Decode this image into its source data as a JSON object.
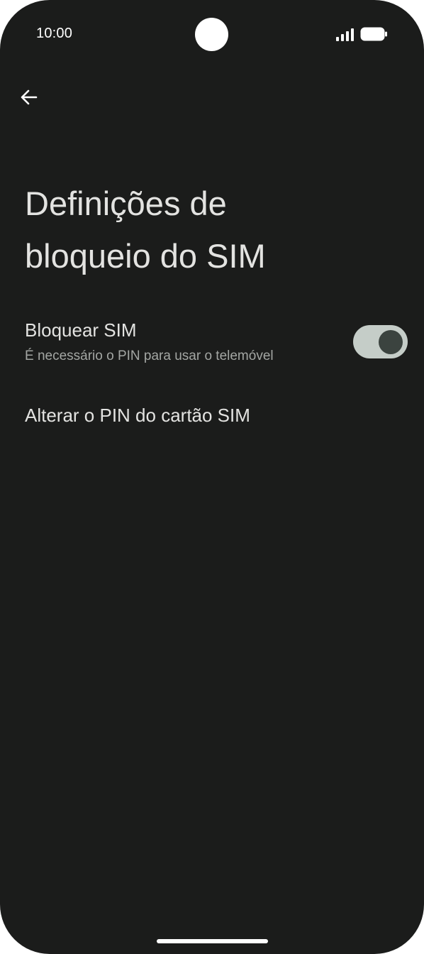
{
  "status_bar": {
    "time": "10:00",
    "icons": [
      "signal-icon",
      "battery-icon"
    ]
  },
  "toolbar": {
    "back_icon": "arrow-back-icon"
  },
  "page": {
    "title_line1": "Definições de",
    "title_line2": "bloqueio do SIM"
  },
  "preferences": {
    "lock_sim": {
      "title": "Bloquear SIM",
      "summary": "É necessário o PIN para usar o telemóvel",
      "toggle_on": true
    },
    "change_pin": {
      "title": "Alterar o PIN do cartão SIM"
    }
  },
  "colors": {
    "background": "#1b1c1b",
    "text_primary": "#e3e3e1",
    "text_secondary": "#a3a6a3",
    "toggle_track": "#c5cdc8",
    "toggle_thumb": "#3b433f"
  }
}
